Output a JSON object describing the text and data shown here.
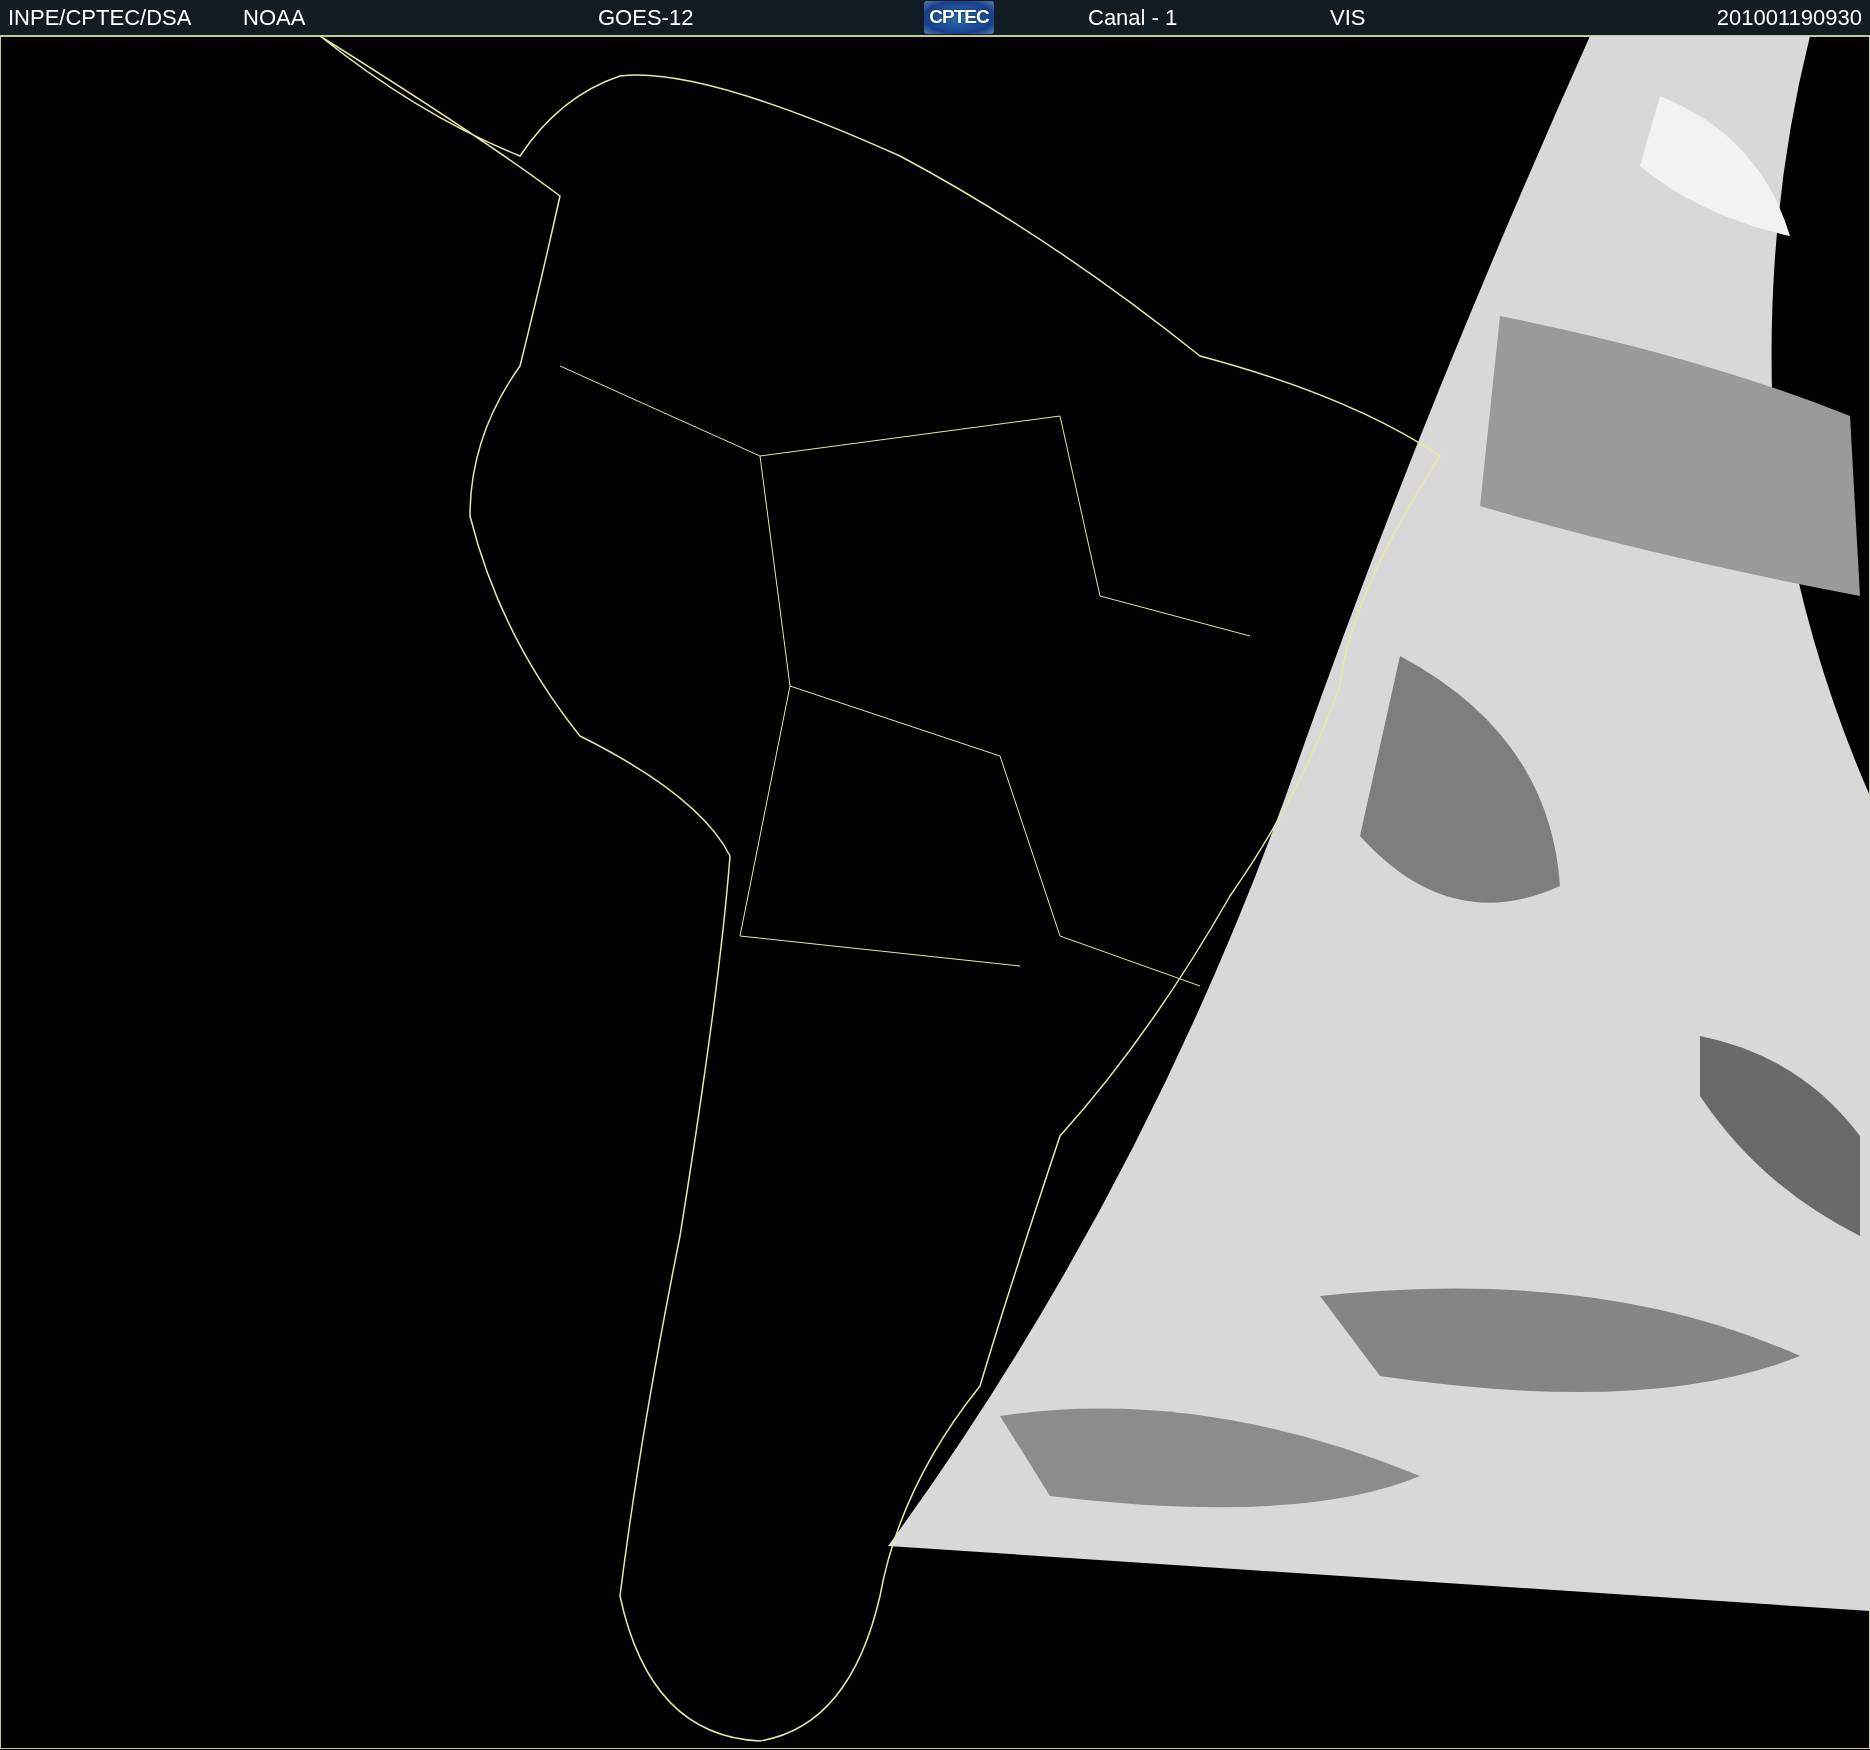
{
  "header": {
    "items": [
      {
        "kind": "text",
        "text": "INPE/CPTEC/DSA"
      },
      {
        "kind": "text",
        "text": "NOAA"
      },
      {
        "kind": "text",
        "text": "GOES-12"
      },
      {
        "kind": "logo",
        "text": "CPTEC"
      },
      {
        "kind": "text",
        "text": "Canal - 1"
      },
      {
        "kind": "text",
        "text": "VIS"
      },
      {
        "kind": "text",
        "text": "201001190930"
      }
    ]
  }
}
